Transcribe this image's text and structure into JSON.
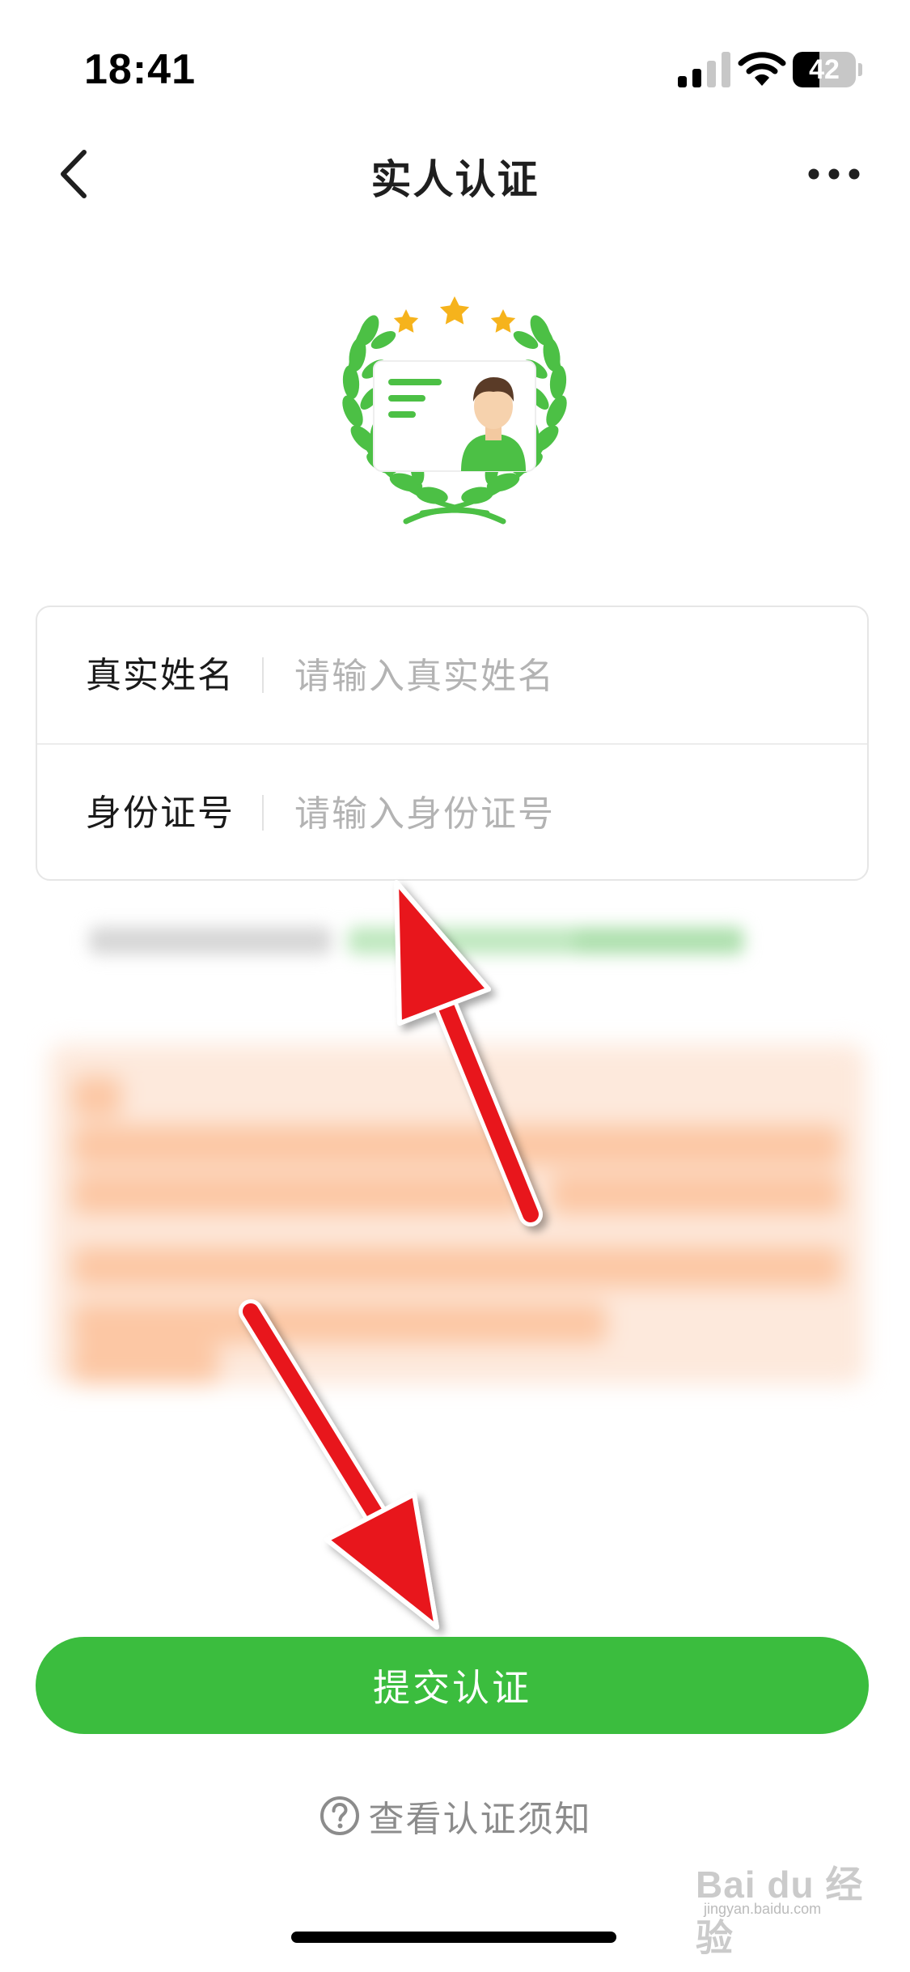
{
  "status_bar": {
    "time": "18:41",
    "battery_level": "42",
    "battery_fraction": 0.42
  },
  "nav": {
    "title": "实人认证",
    "back_icon": "chevron-left-icon",
    "more_icon": "more-horizontal-icon"
  },
  "badge_icon": "verified-id-laurel-icon",
  "form": {
    "fields": [
      {
        "label": "真实姓名",
        "placeholder": "请输入真实姓名",
        "value": ""
      },
      {
        "label": "身份证号",
        "placeholder": "请输入身份证号",
        "value": ""
      }
    ]
  },
  "submit_label": "提交认证",
  "notice_link": "查看认证须知",
  "watermark": {
    "brand": "Bai du 经验",
    "sub": "jingyan.baidu.com"
  },
  "colors": {
    "accent": "#3bbd3e",
    "blurred_notice_bg": "#fde9dc",
    "annotation_arrow": "#e8131b"
  }
}
